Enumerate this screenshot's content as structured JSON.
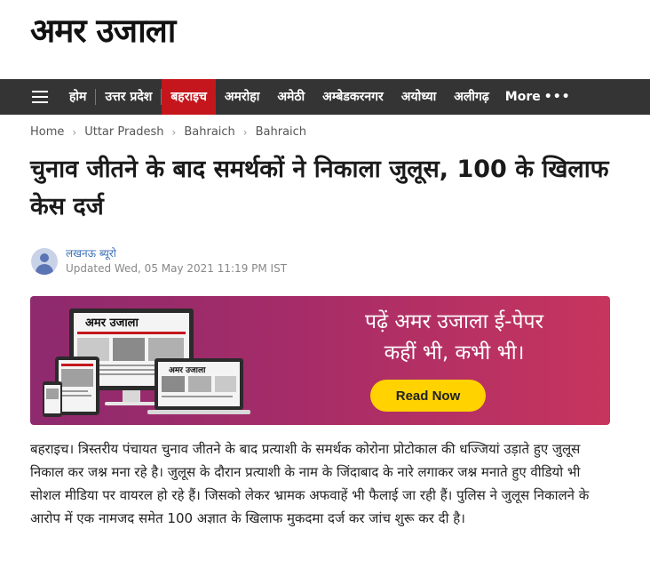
{
  "site": {
    "logo_text": "अमर उजाला"
  },
  "nav": {
    "items": [
      "होम",
      "उत्तर प्रदेश",
      "बहराइच",
      "अमरोहा",
      "अमेठी",
      "अम्बेडकरनगर",
      "अयोध्या",
      "अलीगढ़"
    ],
    "active_index": 2,
    "more_label": "More",
    "active_color": "#c4161c"
  },
  "breadcrumb": [
    "Home",
    "Uttar Pradesh",
    "Bahraich",
    "Bahraich"
  ],
  "article": {
    "title": "चुनाव जीतने के बाद समर्थकों ने निकाला जुलूस, 100 के खिलाफ केस दर्ज",
    "author": "लखनऊ ब्यूरो",
    "updated": "Updated Wed, 05 May 2021 11:19 PM IST",
    "body": "बहराइच। त्रिस्तरीय पंचायत चुनाव जीतने के बाद प्रत्याशी के समर्थक कोरोना प्रोटोकाल की धज्जियां उड़ाते हुए जुलूस निकाल कर जश्न मना रहे है। जुलूस के दौरान प्रत्याशी के नाम के जिंदाबाद के नारे लगाकर जश्न मनाते हुए वीडियो भी सोशल मीडिया पर वायरल हो रहे हैं। जिसको लेकर भ्रामक अफवाहें भी फैलाई जा रही हैं। पुलिस ने जुलूस निकालने के आरोप में एक नामजद समेत 100 अज्ञात के खिलाफ मुकदमा दर्ज कर जांच शुरू कर दी है।"
  },
  "banner": {
    "line1": "पढ़ें अमर उजाला ई-पेपर",
    "line2": "कहीं भी, कभी भी।",
    "button": "Read Now",
    "device_logo": "अमर उजाला",
    "button_color": "#ffd200"
  }
}
